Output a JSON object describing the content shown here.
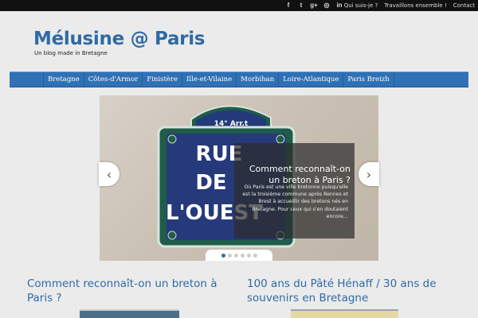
{
  "topbar": {
    "social": [
      {
        "icon": "facebook-icon",
        "glyph": "f"
      },
      {
        "icon": "twitter-icon",
        "glyph": "t"
      },
      {
        "icon": "googleplus-icon",
        "glyph": "g+"
      },
      {
        "icon": "instagram-icon",
        "glyph": "◎"
      },
      {
        "icon": "linkedin-icon",
        "glyph": "in"
      }
    ],
    "links": [
      "Qui suis-je ?",
      "Travaillons ensemble !",
      "Contact"
    ]
  },
  "header": {
    "title": "Mélusine @ Paris",
    "tagline": "Un blog made in Bretagne"
  },
  "nav": {
    "items": [
      "Bretagne",
      "Côtes-d'Armor",
      "Finistère",
      "Ille-et-Vilaine",
      "Morbihan",
      "Loire-Atlantique",
      "Paris Breizh"
    ]
  },
  "slider": {
    "sign": {
      "arr": "14° Arr.t",
      "line1": "RUE",
      "line2": "DE",
      "line3": "L'OUEST"
    },
    "caption_title": "Comment reconnaît-on un breton à Paris ?",
    "caption_text": "Où Paris est une ville bretonne puisqu'elle est la troisième commune après Rennes et Brest à accueillir des bretons nés en Bretagne. Pour ceux qui s'en doutaient encore…",
    "dots": 6,
    "active_dot": 0
  },
  "posts": [
    {
      "title": "Comment reconnaît-on un breton à Paris ?"
    },
    {
      "title": "100 ans du Pâté Hénaff / 30 ans de souvenirs en Bretagne"
    }
  ],
  "colors": {
    "brand": "#2f6aa6",
    "nav": "#3071b5",
    "topbar": "#111111"
  }
}
